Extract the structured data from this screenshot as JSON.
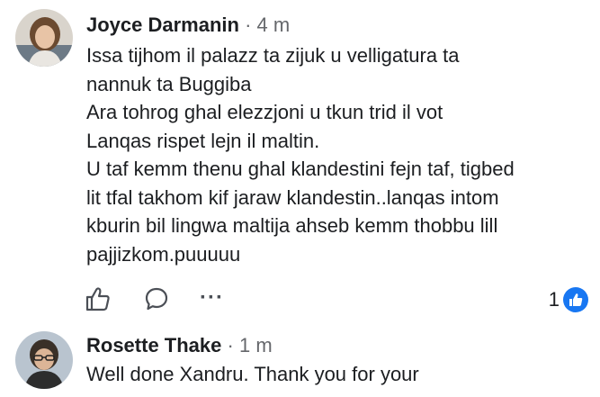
{
  "colors": {
    "accent": "#1877f2",
    "text_primary": "#1c1e21",
    "text_secondary": "#65676b"
  },
  "comments": [
    {
      "author": "Joyce Darmanin",
      "separator": "·",
      "time": "4 m",
      "lines": [
        "Issa tijhom il palazz ta zijuk u  velligatura ta",
        "nannuk ta Buggiba",
        "Ara tohrog ghal elezzjoni u tkun trid il vot",
        "Lanqas rispet lejn il maltin.",
        "U taf kemm thenu ghal klandestini fejn taf, tigbed",
        "lit tfal takhom kif jaraw klandestin..lanqas intom",
        "kburin bil lingwa maltija ahseb kemm thobbu lill",
        "pajjizkom.puuuuu"
      ],
      "actions": {
        "like_icon": "thumbs-up-icon",
        "comment_icon": "speech-bubble-icon",
        "more_label": "···",
        "reaction_count": "1",
        "reaction_icon": "like-badge-icon"
      }
    },
    {
      "author": "Rosette Thake",
      "separator": "·",
      "time": "1 m",
      "lines": [
        "Well done Xandru. Thank you for your"
      ]
    }
  ]
}
